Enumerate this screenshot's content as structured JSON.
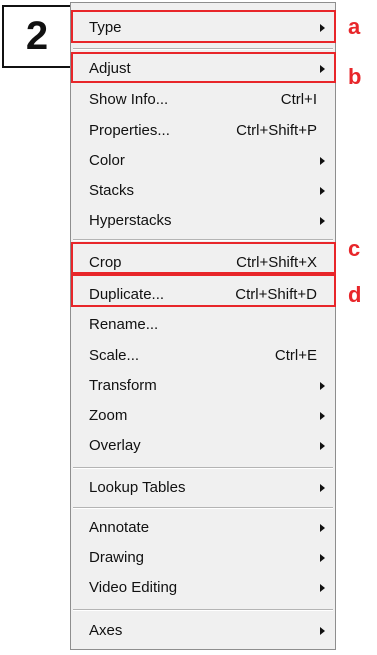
{
  "step_number": "2",
  "menu": {
    "items": [
      {
        "label": "Type",
        "shortcut": "",
        "submenu": true
      },
      {
        "label": "Adjust",
        "shortcut": "",
        "submenu": true
      },
      {
        "label": "Show Info...",
        "shortcut": "Ctrl+I",
        "submenu": false
      },
      {
        "label": "Properties...",
        "shortcut": "Ctrl+Shift+P",
        "submenu": false
      },
      {
        "label": "Color",
        "shortcut": "",
        "submenu": true
      },
      {
        "label": "Stacks",
        "shortcut": "",
        "submenu": true
      },
      {
        "label": "Hyperstacks",
        "shortcut": "",
        "submenu": true
      },
      {
        "label": "Crop",
        "shortcut": "Ctrl+Shift+X",
        "submenu": false
      },
      {
        "label": "Duplicate...",
        "shortcut": "Ctrl+Shift+D",
        "submenu": false
      },
      {
        "label": "Rename...",
        "shortcut": "",
        "submenu": false
      },
      {
        "label": "Scale...",
        "shortcut": "Ctrl+E",
        "submenu": false
      },
      {
        "label": "Transform",
        "shortcut": "",
        "submenu": true
      },
      {
        "label": "Zoom",
        "shortcut": "",
        "submenu": true
      },
      {
        "label": "Overlay",
        "shortcut": "",
        "submenu": true
      },
      {
        "label": "Lookup Tables",
        "shortcut": "",
        "submenu": true
      },
      {
        "label": "Annotate",
        "shortcut": "",
        "submenu": true
      },
      {
        "label": "Drawing",
        "shortcut": "",
        "submenu": true
      },
      {
        "label": "Video Editing",
        "shortcut": "",
        "submenu": true
      },
      {
        "label": "Axes",
        "shortcut": "",
        "submenu": true
      }
    ]
  },
  "annotations": {
    "a": "a",
    "b": "b",
    "c": "c",
    "d": "d"
  },
  "colors": {
    "highlight": "#e8262a",
    "menu_bg": "#f0f0f0"
  }
}
